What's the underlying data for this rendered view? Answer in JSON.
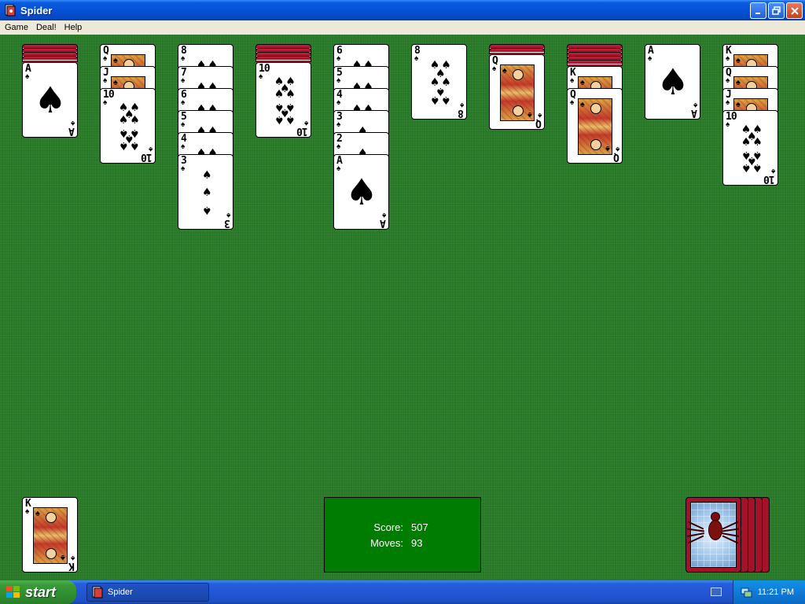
{
  "window": {
    "title": "Spider"
  },
  "menu": [
    "Game",
    "Deal!",
    "Help"
  ],
  "score": {
    "score_label": "Score:",
    "score_value": "507",
    "moves_label": "Moves:",
    "moves_value": "93"
  },
  "taskbar": {
    "start_label": "start",
    "task_label": "Spider",
    "clock": "11:21 PM"
  },
  "colors": {
    "felt": "#287a28",
    "card_back": "#a4122a",
    "score_box": "#007c00"
  },
  "tableau": [
    {
      "hidden": 4,
      "cards": [
        "A♠"
      ]
    },
    {
      "hidden": 0,
      "cards": [
        "Q♠",
        "J♠",
        "10♠"
      ]
    },
    {
      "hidden": 0,
      "cards": [
        "8♠",
        "7♠",
        "6♠",
        "5♠",
        "4♠",
        "3♠"
      ]
    },
    {
      "hidden": 4,
      "cards": [
        "10♠"
      ]
    },
    {
      "hidden": 0,
      "cards": [
        "6♠",
        "5♠",
        "4♠",
        "3♠",
        "2♠",
        "A♠"
      ]
    },
    {
      "hidden": 0,
      "cards": [
        "8♠"
      ]
    },
    {
      "hidden": 2,
      "cards": [
        "Q♠"
      ]
    },
    {
      "hidden": 5,
      "cards": [
        "K♠",
        "Q♠"
      ]
    },
    {
      "hidden": 0,
      "cards": [
        "A♠"
      ]
    },
    {
      "hidden": 0,
      "cards": [
        "K♠",
        "Q♠",
        "J♠",
        "10♠"
      ]
    }
  ],
  "foundation": [
    "K♠"
  ],
  "stock_piles": 5
}
